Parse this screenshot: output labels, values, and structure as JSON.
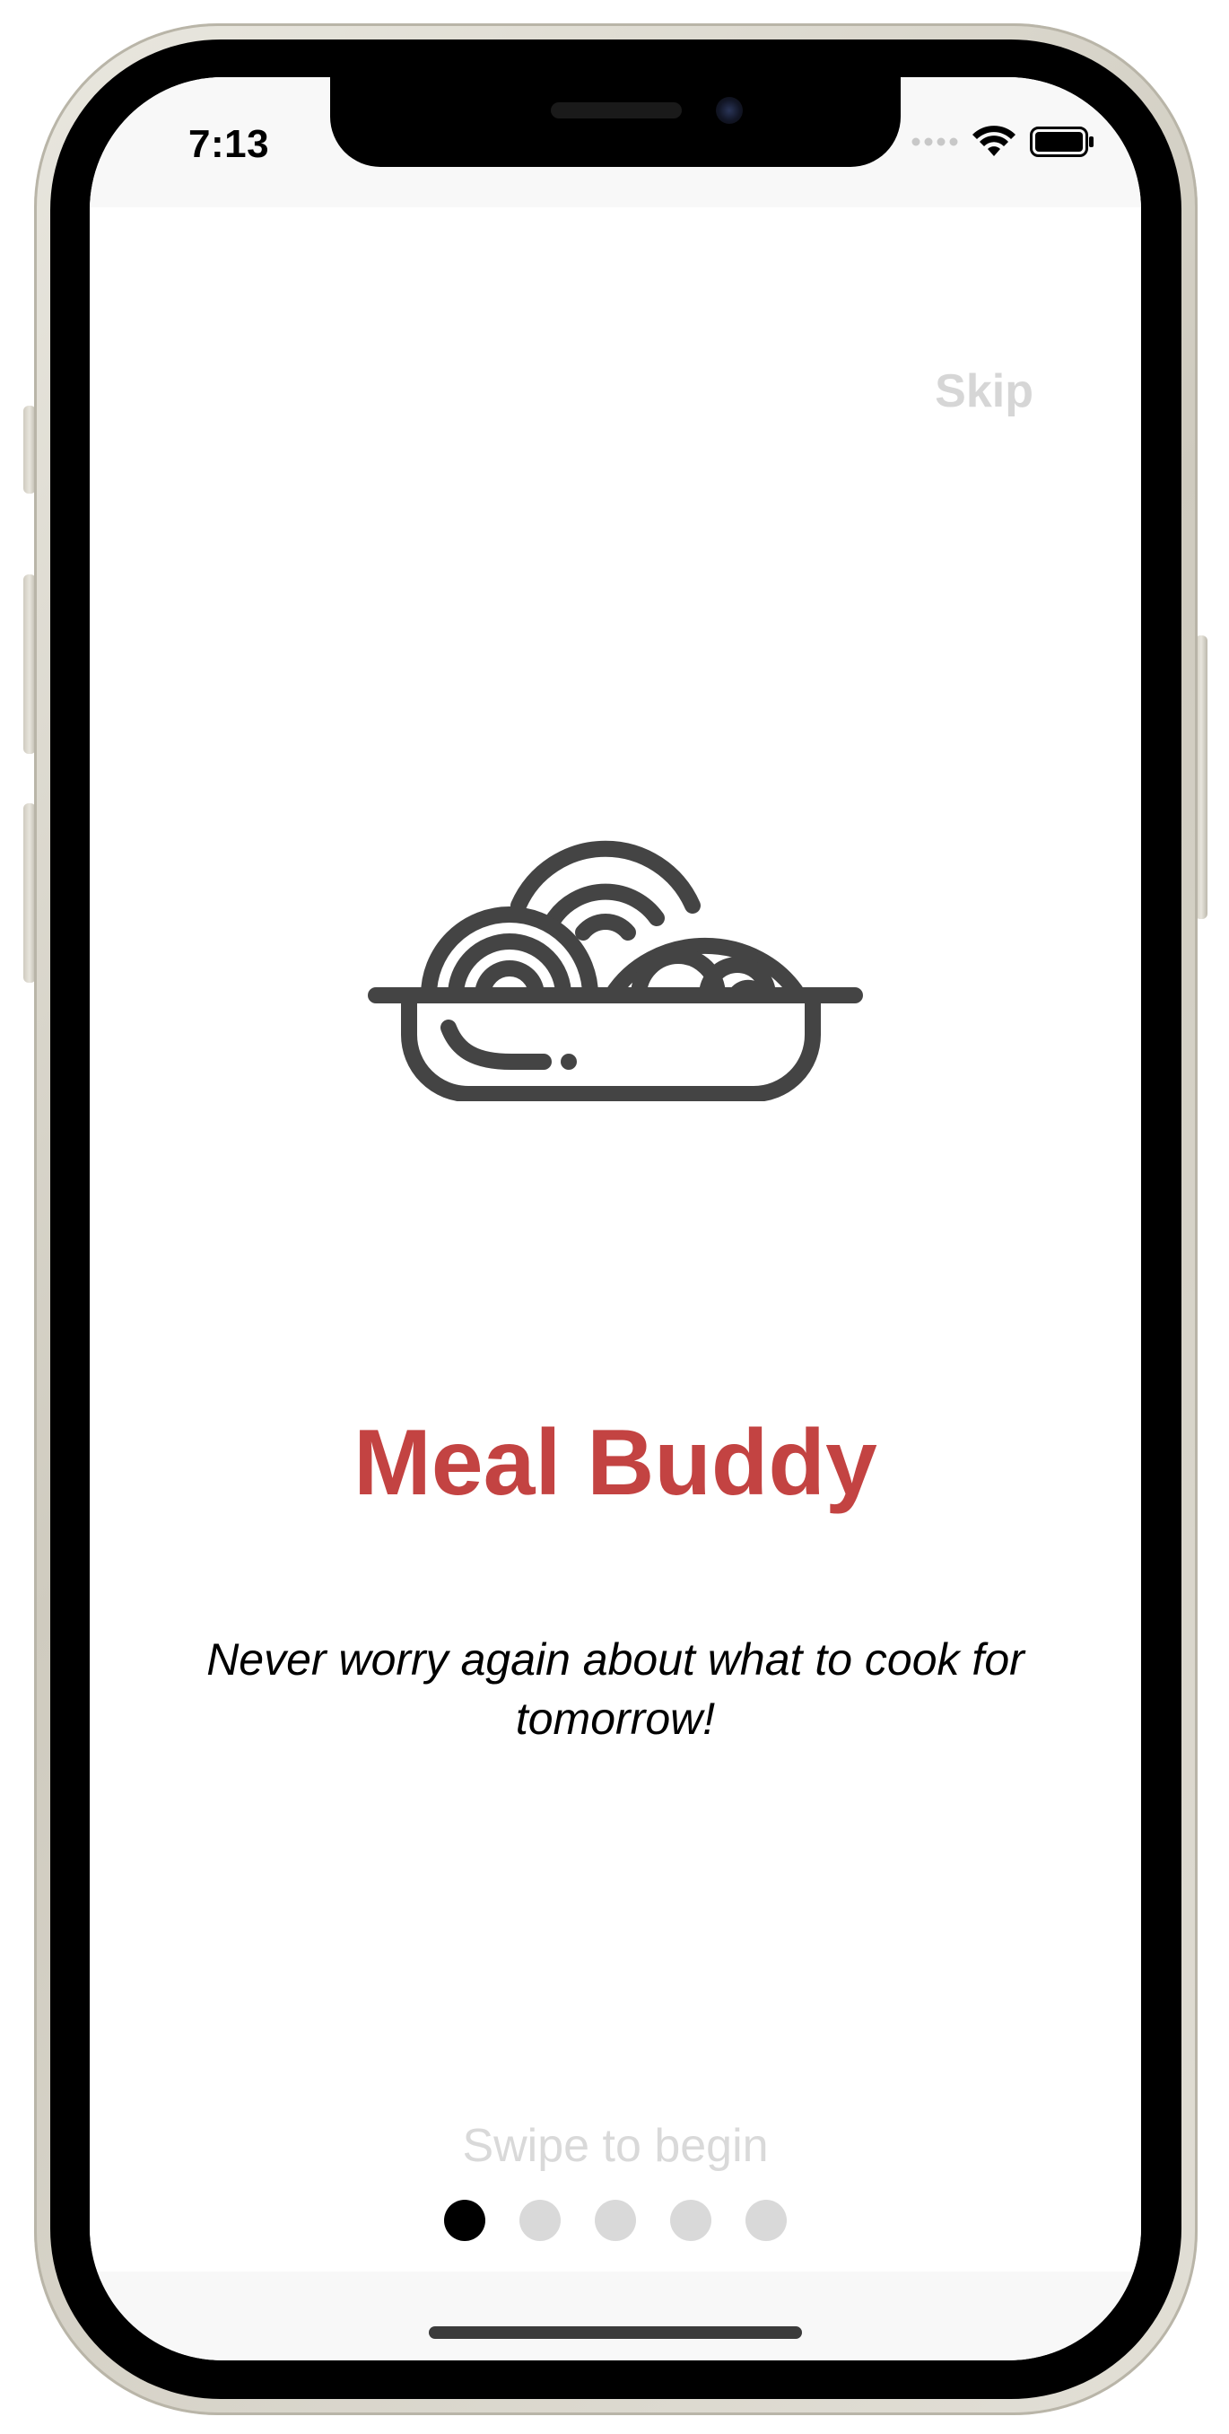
{
  "status_bar": {
    "time": "7:13",
    "icons": [
      "signal-dots-icon",
      "wifi-icon",
      "battery-icon"
    ]
  },
  "onboarding": {
    "skip_label": "Skip",
    "illustration_icon": "noodle-bowl-icon",
    "title": "Meal Buddy",
    "tagline": "Never worry again about what to cook for tomorrow!",
    "swipe_hint": "Swipe to begin",
    "page_indicator": {
      "total_pages": 5,
      "current_page": 1
    }
  },
  "colors": {
    "title": "#c34342",
    "icon": "#444444",
    "muted": "#d9d9d9",
    "active_dot": "#000000"
  }
}
